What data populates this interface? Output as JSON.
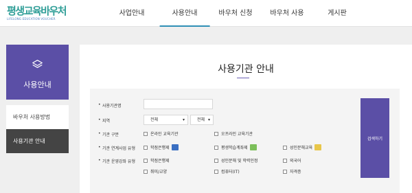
{
  "logo": {
    "text": "평생교육바우처",
    "subtitle": "LIFELONG EDUCATION VOUCHER"
  },
  "nav": [
    {
      "label": "사업안내"
    },
    {
      "label": "사용안내"
    },
    {
      "label": "바우처 신청"
    },
    {
      "label": "바우처 사용"
    },
    {
      "label": "게시판"
    }
  ],
  "nav_active_index": 1,
  "sidebar": {
    "icon": "layers-icon",
    "title": "사용안내",
    "items": [
      {
        "label": "바우처 사용방법"
      },
      {
        "label": "사용기관 안내"
      }
    ],
    "active_index": 1
  },
  "main": {
    "title": "사용기관 안내"
  },
  "filter": {
    "name_label": "사용기관명",
    "name_value": "",
    "region_label": "지역",
    "region_select1": "전체",
    "region_select2": "전체",
    "type_label": "기관 구분",
    "type_options": [
      "온라인 교육기관",
      "오프라인 교육기관"
    ],
    "link_label": "기관 연계사업 유형",
    "link_options": [
      "학점은행제",
      "평생학습계좌제",
      "성인문해교육"
    ],
    "program_label": "기관 운영강좌 유형",
    "program_options": [
      "학점은행제",
      "성인문해 및 학력인정",
      "외국어",
      "취미/교양",
      "컴퓨터(IT)",
      "자격증"
    ],
    "search_button": "검색하기"
  },
  "colors": {
    "brand_purple": "#5b4fa6",
    "logo_teal": "#2f9e97",
    "nav_underline": "#2e8fb5"
  }
}
